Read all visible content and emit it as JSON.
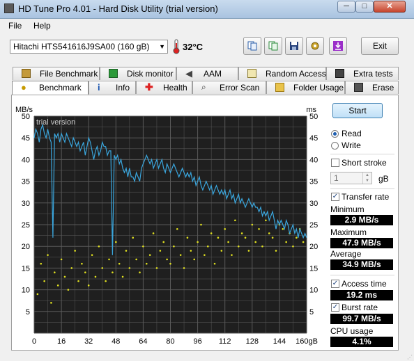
{
  "window": {
    "title": "HD Tune Pro 4.01 - Hard Disk Utility (trial version)",
    "minimize_glyph": "─",
    "maximize_glyph": "□",
    "close_glyph": "✕"
  },
  "menu": {
    "file": "File",
    "help": "Help"
  },
  "toolbar": {
    "drive": "Hitachi HTS541616J9SA00 (160 gB)",
    "temperature": "32°C",
    "exit_label": "Exit",
    "buttons": [
      "copy-icon",
      "copy-info-icon",
      "save-icon",
      "options-icon",
      "download-icon"
    ]
  },
  "tabs": {
    "row1": [
      "File Benchmark",
      "Disk monitor",
      "AAM",
      "Random Access",
      "Extra tests"
    ],
    "row2": [
      "Benchmark",
      "Info",
      "Health",
      "Error Scan",
      "Folder Usage",
      "Erase"
    ],
    "active": "Benchmark"
  },
  "controls": {
    "start_label": "Start",
    "read_label": "Read",
    "write_label": "Write",
    "mode_selected": "Read",
    "short_stroke_label": "Short stroke",
    "short_stroke_checked": false,
    "short_stroke_value": "1",
    "short_stroke_unit": "gB",
    "transfer_rate_label": "Transfer rate",
    "transfer_rate_checked": true,
    "minimum_label": "Minimum",
    "minimum_value": "2.9 MB/s",
    "maximum_label": "Maximum",
    "maximum_value": "47.9 MB/s",
    "average_label": "Average",
    "average_value": "34.9 MB/s",
    "access_time_label": "Access time",
    "access_time_checked": true,
    "access_time_value": "19.2 ms",
    "burst_rate_label": "Burst rate",
    "burst_rate_checked": true,
    "burst_rate_value": "99.7 MB/s",
    "cpu_usage_label": "CPU usage",
    "cpu_usage_value": "4.1%"
  },
  "chart_data": {
    "type": "line",
    "watermark": "trial version",
    "y_left_label": "MB/s",
    "y_right_label": "ms",
    "x_unit_label": "gB",
    "xlim": [
      0,
      160
    ],
    "ylim_left": [
      0,
      50
    ],
    "ylim_right": [
      0,
      50
    ],
    "x_ticks": [
      "0",
      "16",
      "32",
      "48",
      "64",
      "80",
      "96",
      "112",
      "128",
      "144",
      "160gB"
    ],
    "y_ticks": [
      "5",
      "10",
      "15",
      "20",
      "25",
      "30",
      "35",
      "40",
      "45",
      "50"
    ],
    "grid": true,
    "colors": {
      "background": "#1f1f1f",
      "grid": "#5a5a5a",
      "transfer_line": "#3aa6dd",
      "access_points": "#e0e020"
    },
    "series": [
      {
        "name": "Transfer rate",
        "kind": "line",
        "axis": "left",
        "x": [
          0,
          1,
          2,
          3,
          4,
          5,
          6,
          7,
          8,
          9,
          10,
          11,
          12,
          13,
          14,
          15,
          16,
          17,
          18,
          19,
          20,
          21,
          22,
          23,
          24,
          25,
          26,
          27,
          28,
          29,
          30,
          31,
          32,
          33,
          34,
          35,
          36,
          37,
          38,
          39,
          40,
          41,
          42,
          43,
          44,
          45,
          46,
          47,
          48,
          49,
          50,
          51,
          52,
          53,
          54,
          55,
          56,
          57,
          58,
          59,
          60,
          61,
          62,
          63,
          64,
          65,
          66,
          67,
          68,
          69,
          70,
          71,
          72,
          73,
          74,
          75,
          76,
          77,
          78,
          79,
          80,
          81,
          82,
          83,
          84,
          85,
          86,
          87,
          88,
          89,
          90,
          91,
          92,
          93,
          94,
          95,
          96,
          97,
          98,
          99,
          100,
          101,
          102,
          103,
          104,
          105,
          106,
          107,
          108,
          109,
          110,
          111,
          112,
          113,
          114,
          115,
          116,
          117,
          118,
          119,
          120,
          121,
          122,
          123,
          124,
          125,
          126,
          127,
          128,
          129,
          130,
          131,
          132,
          133,
          134,
          135,
          136,
          137,
          138,
          139,
          140,
          141,
          142,
          143,
          144,
          145,
          146,
          147,
          148,
          149,
          150,
          151,
          152,
          153,
          154,
          155,
          156,
          157,
          158,
          159,
          160
        ],
        "y": [
          45,
          47,
          46,
          44,
          47,
          48,
          46,
          45,
          47,
          45,
          44,
          22,
          46,
          45,
          46,
          44,
          46,
          45,
          44,
          46,
          45,
          44,
          43,
          45,
          44,
          43,
          44,
          42,
          43,
          44,
          41,
          43,
          45,
          44,
          42,
          40,
          42,
          43,
          41,
          42,
          44,
          43,
          43,
          41,
          42,
          42,
          18,
          41,
          40,
          41,
          39,
          40,
          38,
          37,
          38,
          36,
          38,
          36,
          36,
          35,
          37,
          36,
          35,
          38,
          39,
          40,
          41,
          40,
          39,
          40,
          38,
          39,
          40,
          38,
          39,
          40,
          38,
          37,
          39,
          38,
          37,
          38,
          39,
          38,
          37,
          36,
          37,
          38,
          37,
          36,
          37,
          36,
          37,
          35,
          36,
          34,
          35,
          36,
          34,
          33,
          34,
          35,
          34,
          33,
          34,
          32,
          33,
          34,
          33,
          32,
          33,
          32,
          33,
          31,
          32,
          33,
          31,
          32,
          30,
          31,
          32,
          30,
          31,
          30,
          29,
          30,
          31,
          30,
          29,
          30,
          29,
          29,
          28,
          29,
          27,
          28,
          27,
          28,
          26,
          27,
          28,
          26,
          24,
          26,
          25,
          26,
          25,
          24,
          26,
          25,
          23,
          24,
          25,
          23,
          24,
          22,
          24,
          23,
          22,
          23,
          22
        ]
      },
      {
        "name": "Access time",
        "kind": "scatter",
        "axis": "right",
        "x": [
          2,
          4,
          6,
          8,
          10,
          12,
          14,
          16,
          18,
          20,
          22,
          24,
          26,
          28,
          30,
          32,
          34,
          36,
          38,
          40,
          42,
          44,
          46,
          48,
          50,
          52,
          54,
          56,
          58,
          60,
          62,
          64,
          66,
          68,
          70,
          72,
          74,
          76,
          78,
          80,
          82,
          84,
          86,
          88,
          90,
          92,
          94,
          96,
          98,
          100,
          102,
          104,
          106,
          108,
          110,
          112,
          114,
          116,
          118,
          120,
          122,
          124,
          126,
          128,
          130,
          132,
          134,
          136,
          138,
          140,
          142,
          144,
          146,
          148,
          150,
          152,
          154,
          156,
          158
        ],
        "y": [
          9,
          16,
          12,
          18,
          7,
          14,
          11,
          17,
          13,
          10,
          15,
          19,
          12,
          16,
          14,
          11,
          18,
          13,
          20,
          15,
          12,
          17,
          14,
          21,
          16,
          13,
          19,
          15,
          22,
          17,
          14,
          20,
          16,
          18,
          23,
          15,
          19,
          21,
          17,
          16,
          20,
          24,
          18,
          15,
          22,
          19,
          17,
          21,
          25,
          18,
          20,
          23,
          16,
          22,
          19,
          24,
          21,
          18,
          26,
          20,
          23,
          22,
          19,
          25,
          21,
          24,
          20,
          26,
          23,
          22,
          19,
          25,
          24,
          21,
          23,
          20,
          22,
          24,
          21
        ]
      }
    ]
  }
}
